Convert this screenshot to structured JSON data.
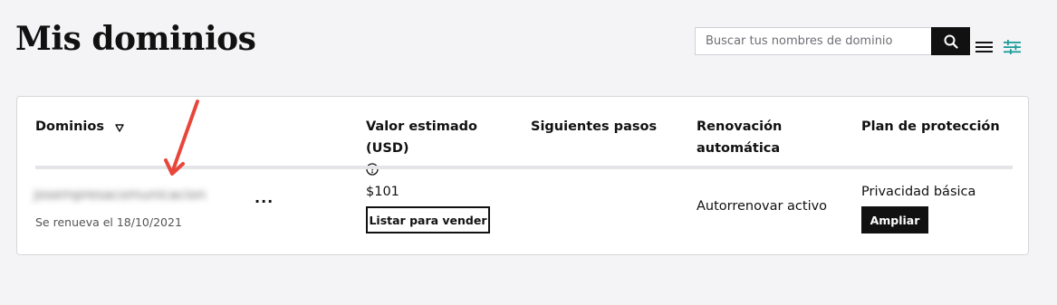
{
  "header": {
    "title": "Mis dominios",
    "search_placeholder": "Buscar tus nombres de dominio",
    "search_value": ""
  },
  "table": {
    "columns": [
      {
        "label": "Dominios"
      },
      {
        "label": "Valor estimado (USD)"
      },
      {
        "label": "Siguientes pasos"
      },
      {
        "label": "Renovación automática"
      },
      {
        "label": "Plan de protección"
      }
    ],
    "rows": [
      {
        "domain": "josempresacomunicacion",
        "domain_truncation": "...",
        "renewal": "Se renueva el 18/10/2021",
        "value": "$101",
        "sell_label": "Listar para vender",
        "autorenew": "Autorrenovar activo",
        "plan": "Privacidad básica",
        "upgrade_label": "Ampliar"
      }
    ]
  },
  "colors": {
    "background": "#f4f4f6",
    "primary": "#111111",
    "accent_teal": "#1b9e9a",
    "annotation_red": "#e8463a"
  },
  "icons": {
    "search": "search-icon",
    "list_view": "list-view-icon",
    "filter": "filter-sliders-icon",
    "sort": "sort-triangle-icon",
    "help": "help-circle-icon"
  }
}
